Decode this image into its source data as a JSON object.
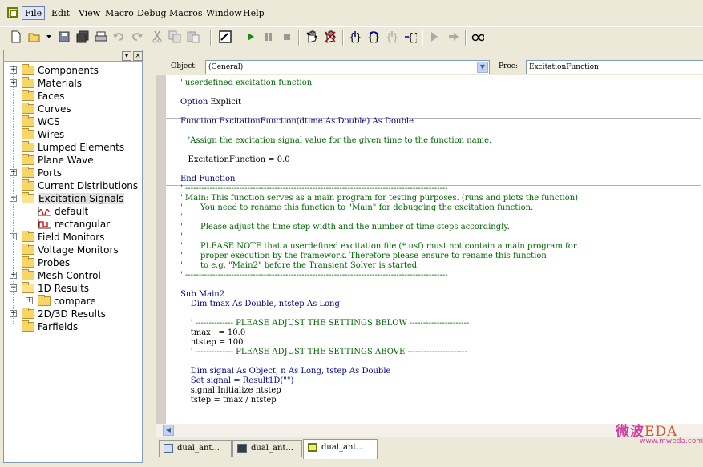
{
  "menubar": {
    "items": [
      "File",
      "Edit",
      "View",
      "Macro",
      "Debug",
      "Macros",
      "Window",
      "Help"
    ]
  },
  "toolbar": {
    "icons": [
      "new-file-icon",
      "open-folder-icon",
      "dropdown-arrow-icon",
      "save-icon",
      "save-all-icon",
      "print-icon",
      "undo-icon",
      "redo-icon",
      "cut-icon",
      "copy-icon",
      "paste-icon",
      "macro-editor-icon",
      "run-icon",
      "pause-icon",
      "stop-icon",
      "breakpoint-icon",
      "clear-breakpoints-icon",
      "step-into-icon",
      "step-over-icon",
      "step-out-icon",
      "step-to-cursor-icon",
      "jump-icon",
      "arrow-right-icon",
      "watch-icon"
    ]
  },
  "tree": {
    "items": [
      {
        "label": "Components",
        "expandable": true,
        "expanded": false
      },
      {
        "label": "Materials",
        "expandable": true,
        "expanded": false
      },
      {
        "label": "Faces",
        "expandable": false
      },
      {
        "label": "Curves",
        "expandable": false
      },
      {
        "label": "WCS",
        "expandable": false
      },
      {
        "label": "Wires",
        "expandable": false
      },
      {
        "label": "Lumped Elements",
        "expandable": false
      },
      {
        "label": "Plane Wave",
        "expandable": false
      },
      {
        "label": "Ports",
        "expandable": true,
        "expanded": false
      },
      {
        "label": "Current Distributions",
        "expandable": false
      },
      {
        "label": "Excitation Signals",
        "expandable": true,
        "expanded": true,
        "selected": true
      },
      {
        "label": "default",
        "child": true
      },
      {
        "label": "rectangular",
        "child": true
      },
      {
        "label": "Field Monitors",
        "expandable": true,
        "expanded": false
      },
      {
        "label": "Voltage Monitors",
        "expandable": false
      },
      {
        "label": "Probes",
        "expandable": false
      },
      {
        "label": "Mesh Control",
        "expandable": true,
        "expanded": false
      },
      {
        "label": "1D Results",
        "expandable": true,
        "expanded": true
      },
      {
        "label": "compare",
        "expandable": true,
        "expanded": false,
        "child": true
      },
      {
        "label": "2D/3D Results",
        "expandable": true,
        "expanded": false
      },
      {
        "label": "Farfields",
        "expandable": false
      }
    ]
  },
  "editor": {
    "object_label": "Object:",
    "object_value": "(General)",
    "proc_label": "Proc:",
    "proc_value": "ExcitationFunction"
  },
  "code": [
    {
      "text": "' userdefined excitation function",
      "cls": "cm"
    },
    {
      "text": "",
      "divider": true
    },
    {
      "text": "Option Explicit",
      "cls": "kw",
      "kwonly": "Option",
      "rest": " Explicit"
    },
    {
      "text": "",
      "divider": true
    },
    {
      "text": "Function ExcitationFunction(dtime As Double) As Double",
      "cls": "kw"
    },
    {
      "text": ""
    },
    {
      "text": "   'Assign the excitation signal value for the given time to the function name.",
      "cls": "cm"
    },
    {
      "text": ""
    },
    {
      "text": "   ExcitationFunction = 0.0"
    },
    {
      "text": ""
    },
    {
      "text": "End Function",
      "cls": "kw",
      "divider": true
    },
    {
      "text": "' -------------------------------------------------------------------------------------------------",
      "cls": "cm"
    },
    {
      "text": "' Main: This function serves as a main program for testing purposes. (runs and plots the function)",
      "cls": "cm"
    },
    {
      "text": "'       You need to rename this function to \"Main\" for debugging the excitation function.",
      "cls": "cm"
    },
    {
      "text": "'",
      "cls": "cm"
    },
    {
      "text": "'       Please adjust the time step width and the number of time steps accordingly.",
      "cls": "cm"
    },
    {
      "text": "'",
      "cls": "cm"
    },
    {
      "text": "'       PLEASE NOTE that a userdefined excitation file (*.usf) must not contain a main program for",
      "cls": "cm"
    },
    {
      "text": "'       proper execution by the framework. Therefore please ensure to rename this function",
      "cls": "cm"
    },
    {
      "text": "'       to e.g. \"Main2\" before the Transient Solver is started",
      "cls": "cm"
    },
    {
      "text": "' -------------------------------------------------------------------------------------------------",
      "cls": "cm"
    },
    {
      "text": ""
    },
    {
      "text": "Sub Main2",
      "cls": "kw"
    },
    {
      "text": "    Dim tmax As Double, ntstep As Long",
      "cls": "kw"
    },
    {
      "text": ""
    },
    {
      "text": "    ' -------------- PLEASE ADJUST THE SETTINGS BELOW ----------------------",
      "cls": "cm"
    },
    {
      "text": "    tmax   = 10.0"
    },
    {
      "text": "    ntstep = 100"
    },
    {
      "text": "    ' -------------- PLEASE ADJUST THE SETTINGS ABOVE ----------------------",
      "cls": "cm"
    },
    {
      "text": ""
    },
    {
      "text": "    Dim signal As Object, n As Long, tstep As Double",
      "cls": "kw"
    },
    {
      "text": "    Set signal = Result1D(\"\")",
      "cls": "kw"
    },
    {
      "text": "    signal.Initialize ntstep"
    },
    {
      "text": "    tstep = tmax / ntstep"
    }
  ],
  "tabs": [
    {
      "label": "dual_ant...",
      "active": false
    },
    {
      "label": "dual_ant...",
      "active": false
    },
    {
      "label": "dual_ant...",
      "active": true
    }
  ],
  "watermark": {
    "main_cn": "微波",
    "main_en": "EDA",
    "sub": "www.mweda.com"
  }
}
